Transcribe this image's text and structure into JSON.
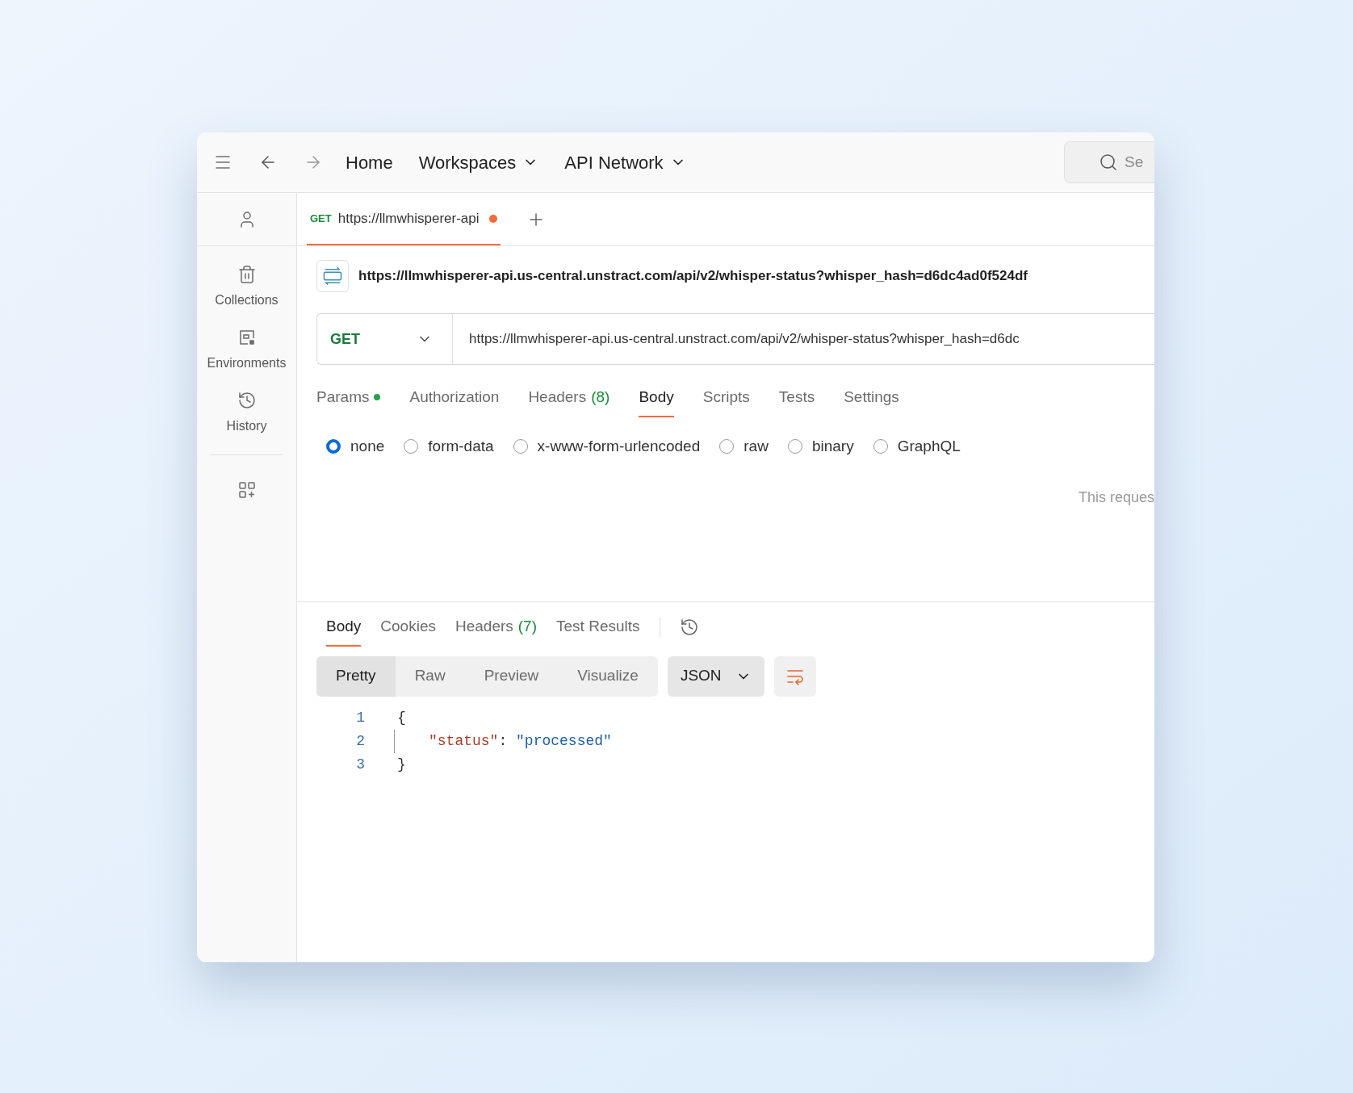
{
  "nav_links": [
    {
      "label": "Home",
      "dropdown": false
    },
    {
      "label": "Workspaces",
      "dropdown": true
    },
    {
      "label": "API Network",
      "dropdown": true
    }
  ],
  "search": {
    "placeholder": "Se"
  },
  "sidebar": {
    "items": [
      {
        "kind": "account"
      },
      {
        "kind": "collections",
        "label": "Collections"
      },
      {
        "kind": "environments",
        "label": "Environments"
      },
      {
        "kind": "history",
        "label": "History"
      },
      {
        "kind": "apps"
      }
    ]
  },
  "tabs": [
    {
      "method": "GET",
      "label": "https://llmwhisperer-api",
      "unsaved": true,
      "selected": true
    }
  ],
  "request": {
    "title": "https://llmwhisperer-api.us-central.unstract.com/api/v2/whisper-status?whisper_hash=d6dc4ad0f524df",
    "method": "GET",
    "url": "https://llmwhisperer-api.us-central.unstract.com/api/v2/whisper-status?whisper_hash=d6dc"
  },
  "request_tabs": [
    {
      "label": "Params",
      "indicator": true,
      "selected": false
    },
    {
      "label": "Authorization",
      "selected": false
    },
    {
      "label": "Headers",
      "count": "(8)",
      "selected": false
    },
    {
      "label": "Body",
      "selected": true
    },
    {
      "label": "Scripts",
      "selected": false
    },
    {
      "label": "Tests",
      "selected": false
    },
    {
      "label": "Settings",
      "selected": false
    }
  ],
  "body_types": [
    {
      "label": "none",
      "selected": true
    },
    {
      "label": "form-data",
      "selected": false
    },
    {
      "label": "x-www-form-urlencoded",
      "selected": false
    },
    {
      "label": "raw",
      "selected": false
    },
    {
      "label": "binary",
      "selected": false
    },
    {
      "label": "GraphQL",
      "selected": false
    }
  ],
  "body_note": "This reques",
  "response_tabs": [
    {
      "label": "Body",
      "selected": true
    },
    {
      "label": "Cookies",
      "selected": false
    },
    {
      "label": "Headers",
      "count": "(7)",
      "selected": false
    },
    {
      "label": "Test Results",
      "selected": false
    }
  ],
  "view_modes": [
    {
      "label": "Pretty",
      "selected": true
    },
    {
      "label": "Raw",
      "selected": false
    },
    {
      "label": "Preview",
      "selected": false
    },
    {
      "label": "Visualize",
      "selected": false
    }
  ],
  "format": "JSON",
  "code_lines": [
    {
      "number": "1",
      "kind": "brace",
      "text": "{"
    },
    {
      "number": "2",
      "kind": "pair",
      "key": "\"status\"",
      "sep": ":",
      "value": "\"processed\""
    },
    {
      "number": "3",
      "kind": "brace",
      "text": "}"
    }
  ]
}
